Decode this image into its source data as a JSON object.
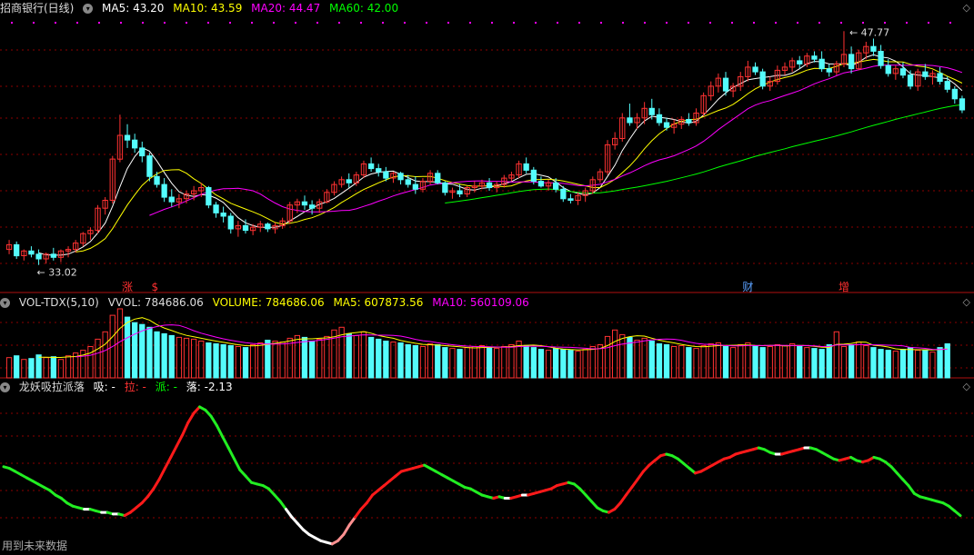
{
  "main_panel": {
    "title": "招商银行(日线)",
    "ma5": "MA5: 43.20",
    "ma10": "MA10: 43.59",
    "ma20": "MA20: 44.47",
    "ma60": "MA60: 42.00",
    "high_label": "47.77",
    "low_label": "33.02",
    "markers": [
      {
        "text": "涨",
        "color": "#ff3030"
      },
      {
        "text": "$",
        "color": "#ff3030"
      },
      {
        "text": "财",
        "color": "#5aa0ff"
      },
      {
        "text": "增",
        "color": "#ff3030"
      }
    ]
  },
  "volume_panel": {
    "title": "VOL-TDX(5,10)",
    "vvol": "VVOL: 784686.06",
    "volume": "VOLUME: 784686.06",
    "ma5": "MA5: 607873.56",
    "ma10": "MA10: 560109.06"
  },
  "indicator_panel": {
    "title": "龙妖吸拉派落",
    "xi": "吸: -",
    "la": "拉: -",
    "pai": "派: -",
    "luo": "落: -2.13"
  },
  "footer": {
    "text": "用到未来数据"
  },
  "colors": {
    "up": "#ff3232",
    "down": "#54fcfc",
    "ma5": "#ffffff",
    "ma10": "#ffff00",
    "ma20": "#ff00ff",
    "ma60": "#00ff00",
    "grid": "#8b0000"
  },
  "chart_data": {
    "type": "candlestick",
    "candles": [
      [
        34.0,
        34.6,
        33.7,
        34.3
      ],
      [
        34.3,
        34.5,
        33.4,
        33.6
      ],
      [
        33.6,
        34.0,
        33.3,
        33.9
      ],
      [
        33.9,
        34.2,
        33.5,
        33.7
      ],
      [
        33.7,
        34.0,
        33.02,
        33.4
      ],
      [
        33.4,
        33.8,
        33.1,
        33.7
      ],
      [
        33.7,
        34.1,
        33.3,
        33.5
      ],
      [
        33.5,
        34.0,
        33.2,
        33.9
      ],
      [
        33.9,
        34.2,
        33.5,
        34.0
      ],
      [
        34.0,
        34.6,
        33.8,
        34.4
      ],
      [
        34.4,
        35.1,
        34.2,
        35.0
      ],
      [
        35.0,
        35.4,
        34.6,
        35.2
      ],
      [
        35.2,
        36.8,
        35.0,
        36.6
      ],
      [
        36.6,
        37.3,
        36.2,
        37.1
      ],
      [
        37.1,
        39.9,
        36.9,
        39.7
      ],
      [
        39.7,
        42.5,
        39.5,
        41.2
      ],
      [
        41.2,
        41.9,
        40.4,
        40.9
      ],
      [
        40.9,
        41.3,
        40.1,
        40.4
      ],
      [
        40.4,
        40.8,
        39.5,
        39.9
      ],
      [
        39.9,
        40.1,
        38.3,
        38.6
      ],
      [
        38.6,
        38.9,
        37.9,
        38.1
      ],
      [
        38.1,
        38.5,
        37.0,
        37.3
      ],
      [
        37.3,
        37.8,
        36.7,
        37.0
      ],
      [
        37.0,
        37.5,
        36.6,
        37.2
      ],
      [
        37.2,
        37.7,
        36.9,
        37.5
      ],
      [
        37.5,
        38.0,
        37.1,
        37.7
      ],
      [
        37.7,
        38.2,
        37.3,
        37.9
      ],
      [
        37.9,
        38.0,
        36.6,
        36.8
      ],
      [
        36.8,
        37.0,
        36.0,
        36.3
      ],
      [
        36.3,
        36.7,
        35.7,
        36.1
      ],
      [
        36.1,
        36.3,
        35.0,
        35.3
      ],
      [
        35.3,
        35.8,
        34.8,
        35.5
      ],
      [
        35.5,
        35.9,
        35.0,
        35.2
      ],
      [
        35.2,
        35.6,
        34.9,
        35.4
      ],
      [
        35.4,
        35.8,
        35.1,
        35.6
      ],
      [
        35.6,
        35.7,
        35.1,
        35.3
      ],
      [
        35.3,
        35.7,
        35.0,
        35.5
      ],
      [
        35.5,
        36.0,
        35.3,
        35.8
      ],
      [
        35.8,
        37.0,
        35.6,
        36.8
      ],
      [
        36.8,
        37.2,
        36.3,
        37.0
      ],
      [
        37.0,
        37.4,
        36.5,
        36.8
      ],
      [
        36.8,
        37.1,
        36.2,
        36.6
      ],
      [
        36.6,
        37.2,
        36.3,
        37.0
      ],
      [
        37.0,
        37.8,
        36.9,
        37.6
      ],
      [
        37.6,
        38.3,
        37.4,
        38.1
      ],
      [
        38.1,
        38.6,
        37.9,
        38.4
      ],
      [
        38.4,
        38.8,
        37.9,
        38.2
      ],
      [
        38.2,
        38.9,
        38.0,
        38.7
      ],
      [
        38.7,
        39.6,
        38.5,
        39.4
      ],
      [
        39.4,
        39.8,
        38.9,
        39.1
      ],
      [
        39.1,
        39.4,
        38.6,
        38.9
      ],
      [
        38.9,
        39.2,
        38.3,
        38.5
      ],
      [
        38.5,
        38.9,
        38.2,
        38.8
      ],
      [
        38.8,
        38.9,
        38.1,
        38.4
      ],
      [
        38.4,
        38.7,
        37.9,
        38.1
      ],
      [
        38.1,
        38.6,
        37.5,
        37.8
      ],
      [
        37.8,
        38.5,
        37.6,
        38.3
      ],
      [
        38.3,
        39.0,
        38.1,
        38.8
      ],
      [
        38.8,
        39.0,
        38.1,
        38.2
      ],
      [
        38.2,
        38.3,
        37.4,
        37.6
      ],
      [
        37.6,
        37.9,
        37.2,
        37.7
      ],
      [
        37.7,
        38.1,
        37.3,
        37.5
      ],
      [
        37.5,
        38.0,
        37.3,
        37.9
      ],
      [
        37.9,
        38.3,
        37.6,
        38.0
      ],
      [
        38.0,
        38.4,
        37.8,
        38.2
      ],
      [
        38.2,
        38.5,
        37.7,
        37.9
      ],
      [
        37.9,
        38.3,
        37.6,
        38.1
      ],
      [
        38.1,
        38.7,
        37.9,
        38.5
      ],
      [
        38.5,
        38.9,
        38.3,
        38.7
      ],
      [
        38.7,
        39.6,
        38.5,
        39.4
      ],
      [
        39.4,
        39.8,
        38.8,
        39.0
      ],
      [
        39.0,
        39.2,
        38.1,
        38.3
      ],
      [
        38.3,
        38.6,
        37.9,
        38.0
      ],
      [
        38.0,
        38.4,
        37.7,
        38.2
      ],
      [
        38.2,
        38.5,
        37.6,
        37.8
      ],
      [
        37.8,
        38.0,
        37.0,
        37.2
      ],
      [
        37.2,
        37.5,
        36.9,
        37.1
      ],
      [
        37.1,
        37.6,
        36.8,
        37.4
      ],
      [
        37.4,
        37.9,
        37.0,
        37.7
      ],
      [
        37.7,
        38.6,
        37.5,
        38.4
      ],
      [
        38.4,
        39.1,
        38.2,
        38.9
      ],
      [
        38.9,
        40.9,
        38.7,
        40.6
      ],
      [
        40.6,
        41.4,
        40.3,
        41.0
      ],
      [
        41.0,
        42.6,
        40.8,
        42.3
      ],
      [
        42.3,
        43.2,
        41.8,
        42.0
      ],
      [
        42.0,
        42.6,
        41.6,
        42.3
      ],
      [
        42.3,
        43.3,
        41.9,
        42.9
      ],
      [
        42.9,
        43.5,
        42.2,
        42.5
      ],
      [
        42.5,
        42.9,
        41.8,
        42.0
      ],
      [
        42.0,
        42.3,
        41.5,
        41.7
      ],
      [
        41.7,
        42.2,
        41.3,
        41.9
      ],
      [
        41.9,
        42.4,
        41.6,
        42.2
      ],
      [
        42.2,
        42.6,
        41.8,
        42.0
      ],
      [
        42.0,
        42.9,
        41.8,
        42.6
      ],
      [
        42.6,
        43.9,
        42.4,
        43.7
      ],
      [
        43.7,
        44.6,
        43.4,
        44.3
      ],
      [
        44.3,
        45.1,
        43.9,
        44.8
      ],
      [
        44.8,
        45.2,
        43.7,
        44.0
      ],
      [
        44.0,
        44.5,
        43.6,
        44.3
      ],
      [
        44.3,
        45.2,
        44.0,
        44.9
      ],
      [
        44.9,
        45.9,
        44.6,
        45.5
      ],
      [
        45.5,
        45.8,
        45.0,
        45.2
      ],
      [
        45.2,
        45.4,
        44.1,
        44.3
      ],
      [
        44.3,
        44.9,
        44.0,
        44.6
      ],
      [
        44.6,
        45.6,
        44.4,
        45.3
      ],
      [
        45.3,
        45.8,
        45.0,
        45.5
      ],
      [
        45.5,
        46.1,
        45.2,
        45.9
      ],
      [
        45.9,
        46.2,
        45.4,
        45.7
      ],
      [
        45.7,
        46.4,
        45.5,
        46.2
      ],
      [
        46.2,
        46.5,
        45.8,
        46.0
      ],
      [
        46.0,
        46.5,
        45.2,
        45.4
      ],
      [
        45.4,
        45.7,
        44.9,
        45.2
      ],
      [
        45.2,
        45.9,
        45.0,
        45.7
      ],
      [
        45.7,
        47.77,
        45.5,
        46.3
      ],
      [
        46.3,
        46.8,
        45.1,
        45.4
      ],
      [
        45.4,
        46.6,
        45.3,
        46.4
      ],
      [
        46.4,
        47.1,
        46.0,
        46.8
      ],
      [
        46.8,
        47.3,
        46.2,
        46.5
      ],
      [
        46.5,
        46.9,
        45.4,
        45.6
      ],
      [
        45.6,
        46.0,
        44.9,
        45.1
      ],
      [
        45.1,
        45.6,
        44.7,
        45.4
      ],
      [
        45.4,
        45.8,
        44.8,
        45.0
      ],
      [
        45.0,
        45.3,
        44.1,
        44.3
      ],
      [
        44.3,
        45.4,
        44.0,
        45.2
      ],
      [
        45.2,
        45.7,
        44.7,
        44.9
      ],
      [
        44.9,
        45.3,
        44.4,
        45.1
      ],
      [
        45.1,
        45.5,
        44.4,
        44.6
      ],
      [
        44.6,
        44.9,
        43.9,
        44.1
      ],
      [
        44.1,
        44.3,
        43.2,
        43.5
      ],
      [
        43.5,
        43.7,
        42.6,
        42.8
      ]
    ],
    "volumes": [
      22,
      24,
      20,
      21,
      25,
      22,
      23,
      20,
      24,
      27,
      30,
      34,
      42,
      50,
      68,
      75,
      66,
      60,
      58,
      55,
      50,
      48,
      46,
      44,
      43,
      42,
      40,
      38,
      37,
      36,
      35,
      34,
      33,
      36,
      38,
      41,
      40,
      39,
      43,
      46,
      44,
      40,
      42,
      45,
      52,
      55,
      48,
      46,
      50,
      44,
      42,
      40,
      39,
      38,
      36,
      35,
      34,
      37,
      36,
      33,
      32,
      31,
      33,
      34,
      35,
      33,
      32,
      34,
      36,
      40,
      35,
      33,
      31,
      30,
      32,
      31,
      30,
      29,
      31,
      34,
      36,
      45,
      52,
      47,
      44,
      41,
      43,
      40,
      37,
      36,
      34,
      35,
      33,
      32,
      35,
      37,
      38,
      34,
      33,
      36,
      38,
      35,
      33,
      34,
      36,
      35,
      37,
      34,
      33,
      32,
      31,
      36,
      50,
      34,
      36,
      39,
      35,
      33,
      31,
      30,
      29,
      31,
      33,
      30,
      30,
      28,
      33,
      37
    ],
    "indicator": [
      80,
      79,
      77,
      75,
      73,
      71,
      69,
      67,
      65,
      62,
      60,
      57,
      55,
      54,
      53,
      53,
      52,
      51,
      51,
      50,
      50,
      49,
      51,
      54,
      57,
      61,
      66,
      72,
      79,
      86,
      93,
      100,
      108,
      114,
      118,
      116,
      112,
      106,
      99,
      92,
      85,
      78,
      74,
      70,
      69,
      68,
      66,
      62,
      58,
      53,
      48,
      44,
      40,
      37,
      35,
      33,
      32,
      31,
      33,
      37,
      43,
      48,
      53,
      57,
      62,
      65,
      68,
      71,
      74,
      77,
      78,
      79,
      80,
      81,
      79,
      77,
      75,
      73,
      71,
      69,
      67,
      66,
      64,
      62,
      61,
      60,
      61,
      60,
      60,
      61,
      62,
      62,
      63,
      64,
      65,
      66,
      68,
      69,
      70,
      69,
      66,
      62,
      58,
      54,
      52,
      51,
      53,
      57,
      62,
      67,
      72,
      77,
      81,
      84,
      87,
      88,
      87,
      85,
      82,
      79,
      76,
      77,
      79,
      81,
      83,
      85,
      86,
      88,
      89,
      90,
      91,
      92,
      91,
      89,
      88,
      88,
      89,
      90,
      91,
      92,
      92,
      91,
      89,
      87,
      85,
      84,
      85,
      86,
      84,
      83,
      84,
      86,
      85,
      83,
      80,
      76,
      72,
      68,
      63,
      61,
      60,
      59,
      58,
      57,
      55,
      52,
      49
    ]
  }
}
